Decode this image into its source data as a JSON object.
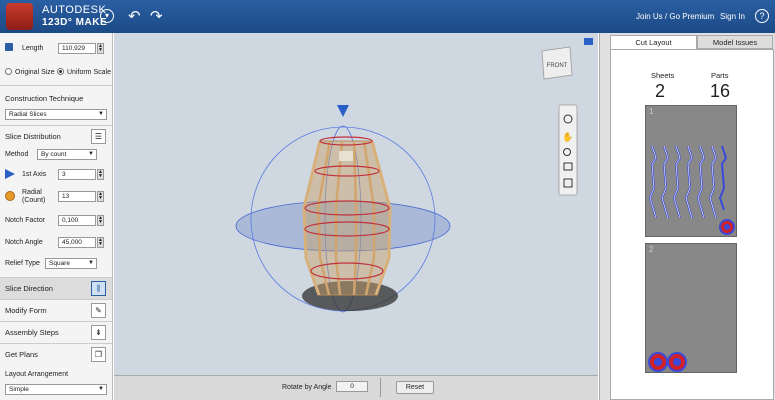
{
  "topbar": {
    "brand_line1": "AUTODESK",
    "brand_line2": "123D° MAKE",
    "join_label": "Join Us / Go Premium",
    "signin_label": "Sign In",
    "help_label": "?",
    "menu_icon": "chevron-down-icon",
    "undo_icon": "undo-icon",
    "redo_icon": "redo-icon"
  },
  "left": {
    "length_label": "Length",
    "length_value": "110,929",
    "original_size_label": "Original Size",
    "uniform_scale_label": "Uniform Scale",
    "scale_mode": "Uniform Scale",
    "construction_title": "Construction Technique",
    "construction_value": "Radial Slices",
    "slice_distribution_title": "Slice Distribution",
    "method_label": "Method",
    "method_value": "By count",
    "axis1_label": "1st Axis",
    "axis1_value": "3",
    "radial_label_1": "Radial",
    "radial_label_2": "(Count)",
    "radial_value": "13",
    "notch_factor_label": "Notch Factor",
    "notch_factor_value": "0,100",
    "notch_angle_label": "Notch Angle",
    "notch_angle_value": "45,000",
    "relief_type_label": "Relief Type",
    "relief_type_value": "Square",
    "slice_direction_label": "Slice Direction",
    "modify_form_label": "Modify Form",
    "assembly_steps_label": "Assembly Steps",
    "get_plans_label": "Get Plans",
    "layout_arrangement_label": "Layout Arrangement",
    "layout_arrangement_value": "Simple"
  },
  "viewport": {
    "viewcube_label": "FRONT",
    "nav_tools": [
      "orbit-icon",
      "pan-hand-icon",
      "zoom-icon",
      "fit-view-icon",
      "home-view-icon"
    ],
    "colors": {
      "background": "#cfd8e1",
      "slice": "#c8a26a",
      "gizmo": "#3a5fc8"
    }
  },
  "bottom": {
    "rotate_label": "Rotate by  Angle",
    "angle_value": "0",
    "reset_label": "Reset"
  },
  "right": {
    "tab_cut_layout": "Cut Layout",
    "tab_model_issues": "Model Issues",
    "active_tab": "Cut Layout",
    "sheets_label": "Sheets",
    "sheets_value": "2",
    "parts_label": "Parts",
    "parts_value": "16",
    "sheet1_number": "1",
    "sheet2_number": "2"
  }
}
